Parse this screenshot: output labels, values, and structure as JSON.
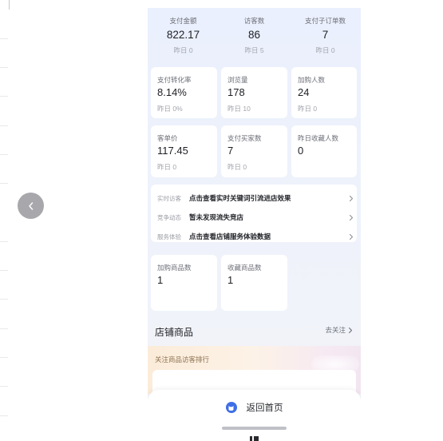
{
  "top_stats": [
    {
      "label": "支付金额",
      "value": "822.17",
      "prev": "昨日 0"
    },
    {
      "label": "访客数",
      "value": "86",
      "prev": "昨日 5"
    },
    {
      "label": "支付子订单数",
      "value": "7",
      "prev": "昨日 0"
    }
  ],
  "metric_cards": [
    {
      "label": "支付转化率",
      "value": "8.14%",
      "prev": "昨日 0%"
    },
    {
      "label": "浏览量",
      "value": "178",
      "prev": "昨日 10"
    },
    {
      "label": "加购人数",
      "value": "24",
      "prev": "昨日 0"
    },
    {
      "label": "客单价",
      "value": "117.45",
      "prev": "昨日 0"
    },
    {
      "label": "支付买家数",
      "value": "7",
      "prev": "昨日 0"
    },
    {
      "label": "昨日收藏人数",
      "value": "0",
      "prev": ""
    }
  ],
  "info_rows": [
    {
      "tag": "实时访客",
      "text": "点击查看实时关键词引流进店效果"
    },
    {
      "tag": "竞争动态",
      "text": "暂未发现流失竞店"
    },
    {
      "tag": "服务体验",
      "text": "点击查看店铺服务体验数据"
    }
  ],
  "goods_cards": [
    {
      "label": "加购商品数",
      "value": "1"
    },
    {
      "label": "收藏商品数",
      "value": "1"
    }
  ],
  "shop_goods": {
    "title": "店铺商品",
    "link": "去关注"
  },
  "rank_banner": {
    "title": "关注商品访客排行"
  },
  "bottom_bar": {
    "home_label": "返回首页"
  },
  "colors": {
    "accent": "#3f6fe6",
    "page_bg": "#eaf0fd",
    "card_bg": "#ffffff"
  },
  "icons": {
    "back": "chevron-left-icon",
    "row_arrow": "chevron-right-icon",
    "home": "home-icon"
  }
}
